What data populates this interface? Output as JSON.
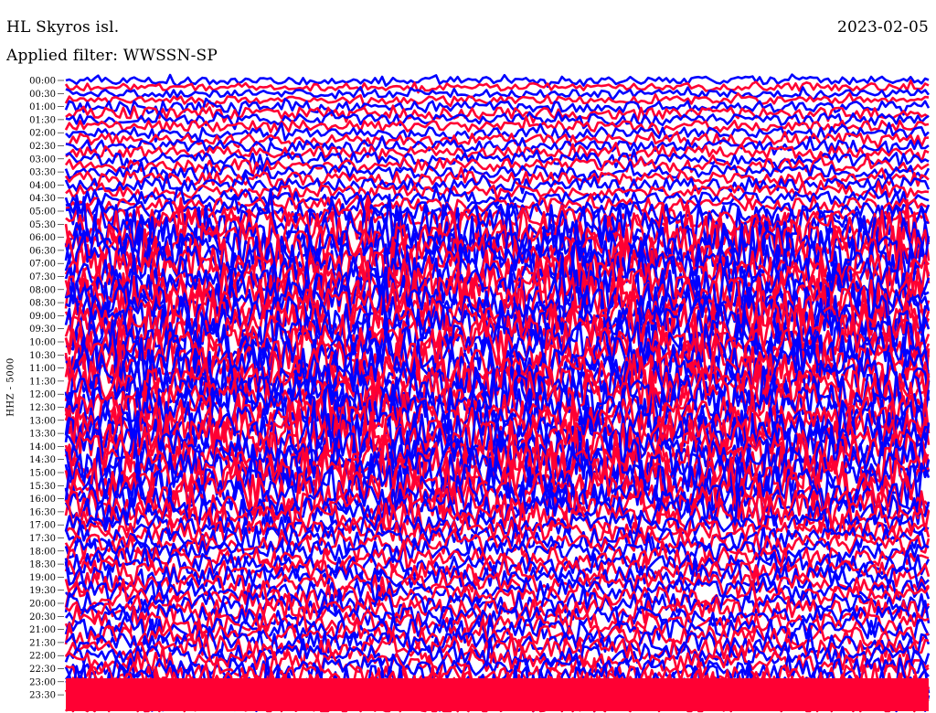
{
  "header": {
    "station": "HL Skyros isl.",
    "date": "2023-02-05",
    "filter_text": "Applied filter: WWSSN-SP"
  },
  "chart_data": {
    "type": "helicorder",
    "title": "HL Skyros isl.",
    "ylabel": "HHZ - 5000",
    "tick_labels": [
      "00:00",
      "00:30",
      "01:00",
      "01:30",
      "02:00",
      "02:30",
      "03:00",
      "03:30",
      "04:00",
      "04:30",
      "05:00",
      "05:30",
      "06:00",
      "06:30",
      "07:00",
      "07:30",
      "08:00",
      "08:30",
      "09:00",
      "09:30",
      "10:00",
      "10:30",
      "11:00",
      "11:30",
      "12:00",
      "12:30",
      "13:00",
      "13:30",
      "14:00",
      "14:30",
      "15:00",
      "15:30",
      "16:00",
      "16:30",
      "17:00",
      "17:30",
      "18:00",
      "18:30",
      "19:00",
      "19:30",
      "20:00",
      "20:30",
      "21:00",
      "21:30",
      "22:00",
      "22:30",
      "23:00",
      "23:30"
    ],
    "trace_colors": [
      "#0000ff",
      "#ff0033"
    ],
    "minutes_per_line": 15,
    "lines": 96
  }
}
